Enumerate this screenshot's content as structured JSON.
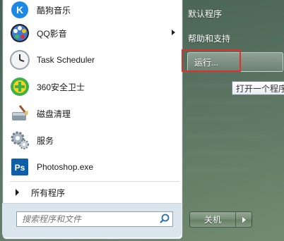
{
  "programs": [
    {
      "label": "酷狗音乐",
      "icon": "kugou-icon",
      "has_submenu": false
    },
    {
      "label": "QQ影音",
      "icon": "qqplayer-icon",
      "has_submenu": true
    },
    {
      "label": "Task Scheduler",
      "icon": "clock-icon",
      "has_submenu": false
    },
    {
      "label": "360安全卫士",
      "icon": "360-security-icon",
      "has_submenu": false
    },
    {
      "label": "磁盘清理",
      "icon": "disk-cleanup-icon",
      "has_submenu": false
    },
    {
      "label": "服务",
      "icon": "services-gear-icon",
      "has_submenu": false
    },
    {
      "label": "Photoshop.exe",
      "icon": "photoshop-icon",
      "has_submenu": false
    }
  ],
  "all_programs_label": "所有程序",
  "search": {
    "placeholder": "搜索程序和文件"
  },
  "right_pane": {
    "default_programs": "默认程序",
    "help_support": "帮助和支持",
    "run": "运行..."
  },
  "tooltip": "打开一个程序",
  "shutdown_label": "关机",
  "colors": {
    "highlight_border": "#e0302e",
    "ps_blue": "#0f5fa8"
  }
}
